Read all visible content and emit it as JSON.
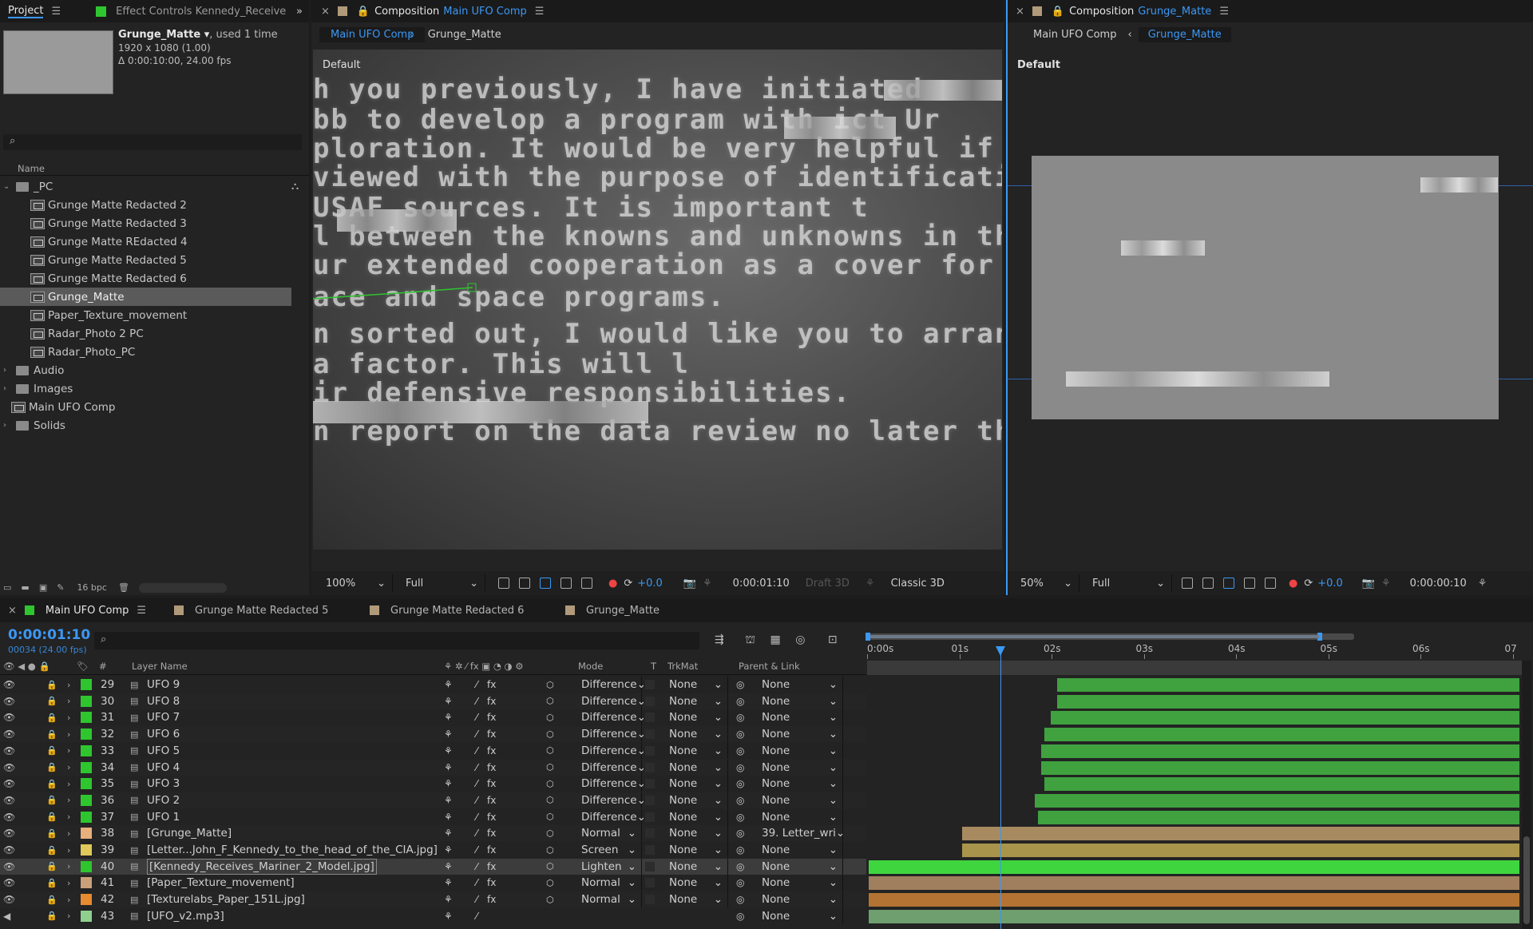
{
  "project": {
    "tab_label": "Project",
    "effect_tab_label": "Effect Controls Kennedy_Receive",
    "item_name": "Grunge_Matte",
    "item_usage": ", used 1 time",
    "item_dims": "1920 x 1080 (1.00)",
    "item_duration": "Δ 0:00:10:00, 24.00 fps",
    "name_header": "Name",
    "bpc_label": "16 bpc",
    "items": [
      {
        "label": "_PC",
        "type": "folder",
        "expanded": true
      },
      {
        "label": "Grunge Matte Redacted 2",
        "type": "comp"
      },
      {
        "label": "Grunge Matte Redacted 3",
        "type": "comp"
      },
      {
        "label": "Grunge Matte REdacted 4",
        "type": "comp"
      },
      {
        "label": "Grunge Matte Redacted 5",
        "type": "comp"
      },
      {
        "label": "Grunge Matte Redacted 6",
        "type": "comp"
      },
      {
        "label": "Grunge_Matte",
        "type": "comp",
        "selected": true
      },
      {
        "label": "Paper_Texture_movement",
        "type": "comp"
      },
      {
        "label": "Radar_Photo 2 PC",
        "type": "comp"
      },
      {
        "label": "Radar_Photo_PC",
        "type": "comp"
      },
      {
        "label": "Audio",
        "type": "folder"
      },
      {
        "label": "Images",
        "type": "folder"
      },
      {
        "label": "Main UFO Comp",
        "type": "comp"
      },
      {
        "label": "Solids",
        "type": "folder"
      }
    ]
  },
  "viewer_left": {
    "tab_prefix": "Composition",
    "tab_comp": "Main UFO Comp",
    "crumb_active": "Main UFO Comp",
    "crumb_other": "Grunge_Matte",
    "view_label": "Default",
    "zoom": "100%",
    "resolution": "Full",
    "exposure": "+0.0",
    "timecode": "0:00:01:10",
    "draft3d": "Draft 3D",
    "renderer": "Classic 3D",
    "doc_lines": [
      "h you previously, I have initiated",
      "bb to develop a program with         ict Ur",
      "ploration. It would be very helpful if you",
      "viewed with the purpose of identification",
      "          USAF sources.  It is important t",
      "l between the knowns and unknowns in the ar",
      "ur extended cooperation as a cover for int",
      "ace and space programs.",
      "n sorted out, I would like you to arrange",
      "                  a factor. This will l",
      "ir defensive responsibilities.",
      "n report on the data review no later than"
    ]
  },
  "viewer_right": {
    "tab_prefix": "Composition",
    "tab_comp": "Grunge_Matte",
    "crumb_other": "Main UFO Comp",
    "crumb_active": "Grunge_Matte",
    "view_label": "Default",
    "zoom": "50%",
    "resolution": "Full",
    "exposure": "+0.0",
    "timecode": "0:00:00:10"
  },
  "timeline": {
    "tabs": [
      "Main UFO Comp",
      "Grunge Matte Redacted 5",
      "Grunge Matte Redacted 6",
      "Grunge_Matte"
    ],
    "timecode": "0:00:01:10",
    "frame_info": "00034 (24.00 fps)",
    "search_placeholder": "",
    "headers": {
      "num": "#",
      "layer_name": "Layer Name",
      "mode": "Mode",
      "t": "T",
      "trkmat": "TrkMat",
      "parent": "Parent & Link"
    },
    "ruler": [
      "0:00s",
      "01s",
      "02s",
      "03s",
      "04s",
      "05s",
      "06s",
      "07"
    ],
    "layers": [
      {
        "num": "29",
        "name": "UFO 9",
        "color": "#2fc52f",
        "mode": "Difference",
        "trkmat": "None",
        "parent": "None",
        "start": 0.29,
        "bar": "#3fa23f"
      },
      {
        "num": "30",
        "name": "UFO 8",
        "color": "#2fc52f",
        "mode": "Difference",
        "trkmat": "None",
        "parent": "None",
        "start": 0.29,
        "bar": "#3fa23f"
      },
      {
        "num": "31",
        "name": "UFO 7",
        "color": "#2fc52f",
        "mode": "Difference",
        "trkmat": "None",
        "parent": "None",
        "start": 0.28,
        "bar": "#3fa23f"
      },
      {
        "num": "32",
        "name": "UFO 6",
        "color": "#2fc52f",
        "mode": "Difference",
        "trkmat": "None",
        "parent": "None",
        "start": 0.27,
        "bar": "#3fa23f"
      },
      {
        "num": "33",
        "name": "UFO 5",
        "color": "#2fc52f",
        "mode": "Difference",
        "trkmat": "None",
        "parent": "None",
        "start": 0.265,
        "bar": "#3fa23f"
      },
      {
        "num": "34",
        "name": "UFO 4",
        "color": "#2fc52f",
        "mode": "Difference",
        "trkmat": "None",
        "parent": "None",
        "start": 0.265,
        "bar": "#3fa23f"
      },
      {
        "num": "35",
        "name": "UFO 3",
        "color": "#2fc52f",
        "mode": "Difference",
        "trkmat": "None",
        "parent": "None",
        "start": 0.27,
        "bar": "#3fa23f"
      },
      {
        "num": "36",
        "name": "UFO 2",
        "color": "#2fc52f",
        "mode": "Difference",
        "trkmat": "None",
        "parent": "None",
        "start": 0.255,
        "bar": "#3fa23f"
      },
      {
        "num": "37",
        "name": "UFO 1",
        "color": "#2fc52f",
        "mode": "Difference",
        "trkmat": "None",
        "parent": "None",
        "start": 0.26,
        "bar": "#3fa23f"
      },
      {
        "num": "38",
        "name": "[Grunge_Matte]",
        "color": "#e8b07c",
        "mode": "Normal",
        "trkmat": "None",
        "parent": "39. Letter_wri",
        "start": 0.143,
        "bar": "#a88a60"
      },
      {
        "num": "39",
        "name": "[Letter...John_F_Kennedy_to_the_head_of_the_CIA.jpg]",
        "color": "#e0c85a",
        "mode": "Screen",
        "trkmat": "None",
        "parent": "None",
        "start": 0.143,
        "bar": "#a9944b"
      },
      {
        "num": "40",
        "name": "[Kennedy_Receives_Mariner_2_Model.jpg]",
        "color": "#2fc52f",
        "mode": "Lighten",
        "trkmat": "None",
        "parent": "None",
        "start": 0.0,
        "bar": "#3fd53f",
        "selected": true
      },
      {
        "num": "41",
        "name": "[Paper_Texture_movement]",
        "color": "#c9a07a",
        "mode": "Normal",
        "trkmat": "None",
        "parent": "None",
        "start": 0.0,
        "bar": "#a07f5e"
      },
      {
        "num": "42",
        "name": "[Texturelabs_Paper_151L.jpg]",
        "color": "#e88a2f",
        "mode": "Normal",
        "trkmat": "None",
        "parent": "None",
        "start": 0.0,
        "bar": "#b37433"
      },
      {
        "num": "43",
        "name": "[UFO_v2.mp3]",
        "color": "#8fd08f",
        "mode": "",
        "trkmat": "",
        "parent": "None",
        "start": 0.0,
        "bar": "#6f9e6f"
      }
    ]
  }
}
